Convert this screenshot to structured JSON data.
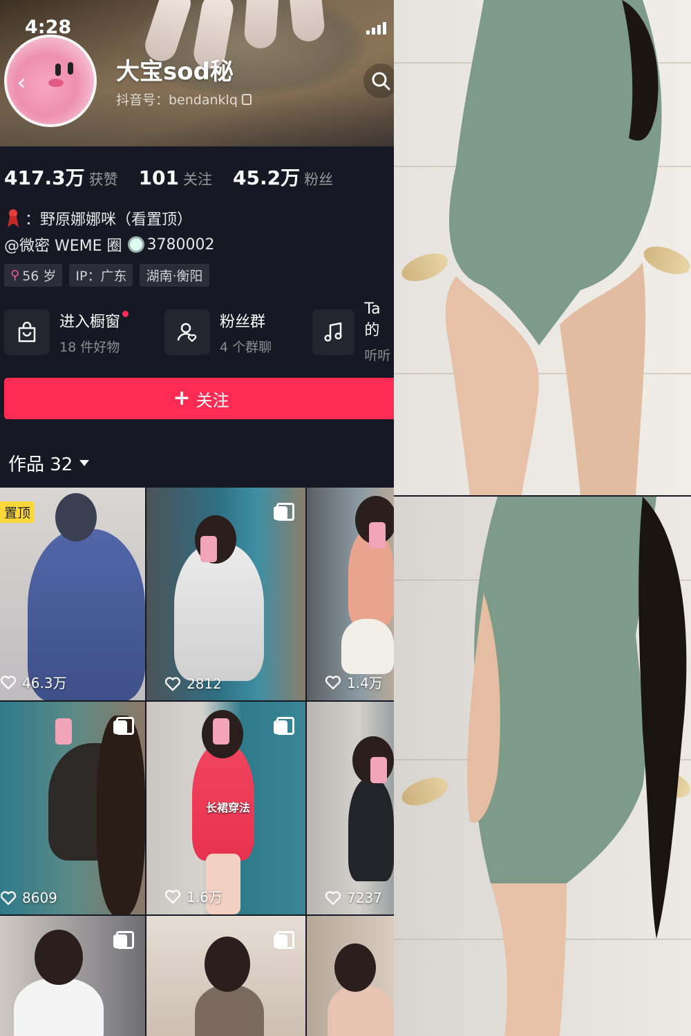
{
  "status": {
    "time": "4:28"
  },
  "profile": {
    "name": "大宝sod秘",
    "douyin_id": "抖音号：bendanklq"
  },
  "stats": [
    {
      "value": "417.3万",
      "label": "获赞"
    },
    {
      "value": "101",
      "label": "关注"
    },
    {
      "value": "45.2万",
      "label": "粉丝"
    }
  ],
  "bio": {
    "line1": "：野原娜娜咪（看置顶）",
    "line2_handle": "@微密 WEME 圈",
    "line2_number": "3780002"
  },
  "tags": [
    "56 岁",
    "IP：广东",
    "湖南·衡阳"
  ],
  "features": [
    {
      "title": "进入橱窗",
      "subtitle": "18 件好物",
      "icon": "shopping-bag-icon"
    },
    {
      "title": "粉丝群",
      "subtitle": "4 个群聊",
      "icon": "fan-group-icon"
    },
    {
      "title": "Ta 的",
      "subtitle": "听听",
      "icon": "music-note-icon"
    }
  ],
  "follow_button": {
    "label": "关注"
  },
  "works_tab": {
    "label": "作品 32"
  },
  "grid": {
    "pin_label": "置顶",
    "overlay_text": "长裙穿法",
    "items": [
      {
        "likes": "46.3万",
        "pinned": true
      },
      {
        "likes": "2812",
        "multi": true
      },
      {
        "likes": "1.4万"
      },
      {
        "likes": "8609",
        "multi": true
      },
      {
        "likes": "1.6万",
        "multi": true
      },
      {
        "likes": "7237"
      },
      {
        "likes": "",
        "multi": true
      },
      {
        "likes": "",
        "multi": true
      },
      {
        "likes": ""
      }
    ]
  },
  "colors": {
    "background": "#161823",
    "accent": "#fe2c55",
    "pin_badge": "#fdd83a"
  }
}
